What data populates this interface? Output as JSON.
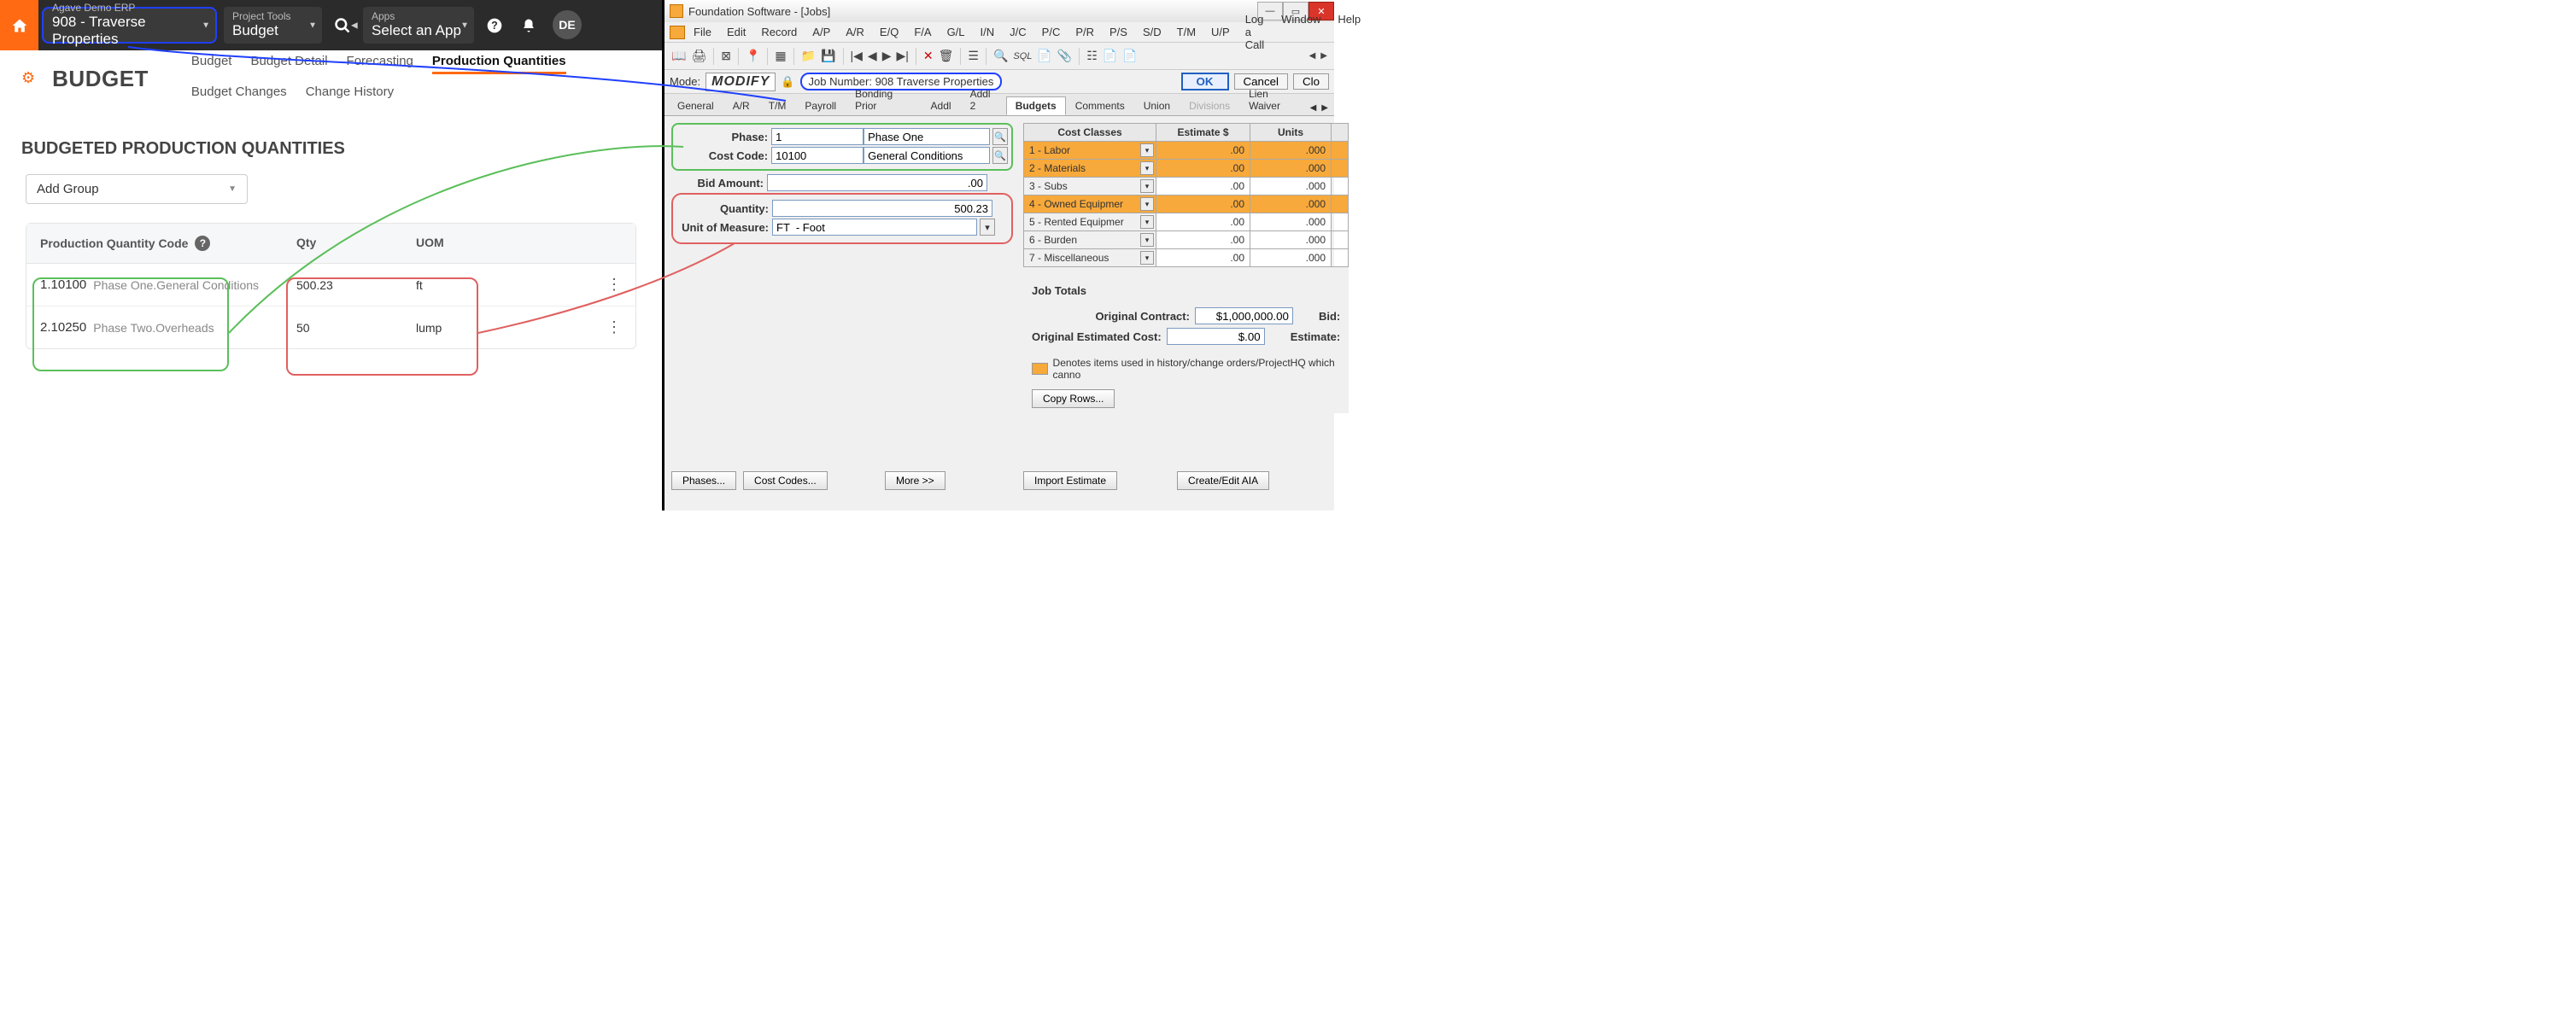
{
  "erp": {
    "topbar": {
      "company": "Agave Demo ERP",
      "job": "908 - Traverse Properties",
      "tools_label": "Project Tools",
      "tools_value": "Budget",
      "apps_label": "Apps",
      "apps_value": "Select an App",
      "avatar": "DE"
    },
    "page_title": "BUDGET",
    "tabs": [
      "Budget",
      "Budget Detail",
      "Forecasting",
      "Production Quantities",
      "Budget Changes",
      "Change History"
    ],
    "section": "BUDGETED PRODUCTION QUANTITIES",
    "add_group": "Add Group",
    "columns": {
      "c1": "Production Quantity Code",
      "c2": "Qty",
      "c3": "UOM"
    },
    "rows": [
      {
        "code": "1.10100",
        "desc": "Phase One.General Conditions",
        "qty": "500.23",
        "uom": "ft"
      },
      {
        "code": "2.10250",
        "desc": "Phase Two.Overheads",
        "qty": "50",
        "uom": "lump"
      }
    ]
  },
  "fs": {
    "title": "Foundation Software - [Jobs]",
    "menu": [
      "File",
      "Edit",
      "Record",
      "A/P",
      "A/R",
      "E/Q",
      "F/A",
      "G/L",
      "I/N",
      "J/C",
      "P/C",
      "P/R",
      "P/S",
      "S/D",
      "T/M",
      "U/P"
    ],
    "menu_right": [
      "Log a Call",
      "Window",
      "Help"
    ],
    "mode_label": "Mode:",
    "mode_value": "MODIFY",
    "job_label": "Job Number: 908  Traverse Properties",
    "ok": "OK",
    "cancel": "Cancel",
    "close": "Clo",
    "tabs": [
      "General",
      "A/R",
      "T/M",
      "Payroll",
      "Bonding Prior",
      "Addl",
      "Addl 2",
      "Budgets",
      "Comments",
      "Union",
      "Divisions",
      "Lien Waiver"
    ],
    "form": {
      "phase_lbl": "Phase:",
      "phase_num": "1",
      "phase_desc": "Phase One",
      "cc_lbl": "Cost Code:",
      "cc_num": "10100",
      "cc_desc": "General Conditions",
      "bid_lbl": "Bid Amount:",
      "bid_val": ".00",
      "qty_lbl": "Quantity:",
      "qty_val": "500.23",
      "uom_lbl": "Unit of Measure:",
      "uom_val": "FT  - Foot"
    },
    "grid_head": {
      "c1": "Cost Classes",
      "c2": "Estimate $",
      "c3": "Units"
    },
    "grid": [
      {
        "n": "1  - Labor",
        "e": ".00",
        "u": ".000",
        "hl": true
      },
      {
        "n": "2  - Materials",
        "e": ".00",
        "u": ".000",
        "hl": true
      },
      {
        "n": "3  - Subs",
        "e": ".00",
        "u": ".000",
        "hl": false
      },
      {
        "n": "4  - Owned Equipmer",
        "e": ".00",
        "u": ".000",
        "hl": true
      },
      {
        "n": "5  - Rented Equipmer",
        "e": ".00",
        "u": ".000",
        "hl": false
      },
      {
        "n": "6  - Burden",
        "e": ".00",
        "u": ".000",
        "hl": false
      },
      {
        "n": "7  - Miscellaneous",
        "e": ".00",
        "u": ".000",
        "hl": false
      }
    ],
    "totals": {
      "title": "Job Totals",
      "orig_contract_lbl": "Original Contract:",
      "orig_contract": "$1,000,000.00",
      "bid_lbl2": "Bid:",
      "oec_lbl": "Original Estimated Cost:",
      "oec": "$.00",
      "est_lbl": "Estimate:"
    },
    "note": "Denotes items used in history/change orders/ProjectHQ which canno",
    "btns": {
      "copy": "Copy Rows...",
      "import": "Import Estimate",
      "aia": "Create/Edit AIA",
      "phases": "Phases...",
      "costcodes": "Cost Codes...",
      "more": "More >>"
    }
  }
}
